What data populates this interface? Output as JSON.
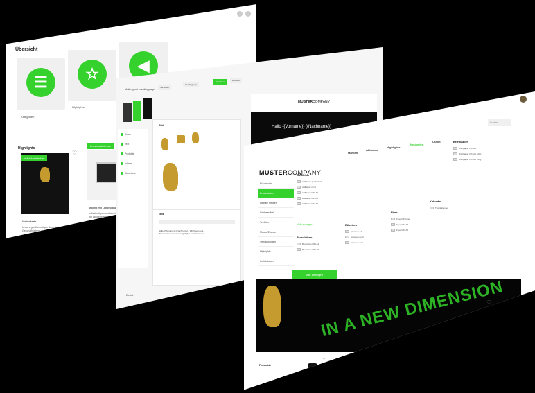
{
  "panel_overview": {
    "title": "Übersicht",
    "tiles": [
      {
        "label": "Kategorien",
        "icon": "list-icon"
      },
      {
        "label": "Highlights",
        "icon": "star-icon"
      },
      {
        "label": "",
        "icon": "megaphone-icon"
      }
    ],
    "highlights_title": "Highlights",
    "cards": [
      {
        "badge": "Individualisierbar",
        "title": "Visitenkarte",
        "text": "Unsere großformatigen Begleiter im Geschäftsleben, der edel auffällt."
      },
      {
        "badge": "Individualisierbar",
        "title": "Mailing mit Landingpage",
        "text": "Individuell personalisiertes Mailing mit Landingpage als Reaktions-..."
      }
    ]
  },
  "panel_editor": {
    "title": "Mailing mit Landingpage",
    "toolbar": [
      "Vorschau",
      "Landingpage",
      "Speichern",
      "Drucken"
    ],
    "side_items": [
      "Cover",
      "Text",
      "Produkte",
      "Inhalte",
      "Abschluss"
    ],
    "image_section": "Bild",
    "text_section": "Text",
    "text_body": "Hallo {{Vorname}} {{Nachname}}, Wir freuen uns, Ihnen unsere neuesten Highlights zu präsentieren.",
    "back_label": "Zurück",
    "mail_logo_bold": "MUSTER",
    "mail_logo_rest": "COMPANY",
    "mail_greeting": "Hallo {{Vorname}} {{Nachname}}"
  },
  "panel_shop": {
    "logo_bold": "MUSTER",
    "logo_rest": "COMPANY",
    "search_placeholder": "Suchen",
    "menu": [
      "Bürobedarf",
      "Drucksachen",
      "Digitale Medien",
      "Werbeartikel",
      "Textilien",
      "Messe/Events",
      "Verpackungen",
      "Highlights",
      "Kollektionen"
    ],
    "nav": [
      "Marken",
      "Aktionen",
      "Highlights",
      "Neuheiten",
      "Outlet"
    ],
    "columns": [
      {
        "head": "Aufkleber",
        "items": [
          "Aufkleber quadratisch",
          "Aufkleber rund",
          "Aufkleber DIN A5",
          "Aufkleber DIN A4",
          "Aufkleber DIN A3"
        ]
      },
      {
        "head": "Briefpapier",
        "items": [
          "Briefpapier DIN A4",
          "Briefpapier DIN A4 100g",
          "Briefpapier DIN A4 120g",
          "Briefpapier DIN A4 90g",
          "Briefpapier DIN A4 80g"
        ]
      },
      {
        "head": "Broschüren",
        "items": [
          "Broschüre DIN A4",
          "Broschüre DIN A5"
        ]
      },
      {
        "head": "Etiketten",
        "items": [
          "Etiketten A4",
          "Etiketten rund",
          "Etiketten oval"
        ]
      },
      {
        "head": "Flyer",
        "items": [
          "Flyer DIN lang",
          "Flyer DIN A6",
          "Flyer DIN A5"
        ]
      },
      {
        "head": "Kalender",
        "items": [
          "Tischkalender"
        ]
      }
    ],
    "more_link": "Mehr anzeigen",
    "all_products": "Alle anzeigen",
    "hero_slogan": "IN A NEW DIMENSION",
    "products_title": "Produkte"
  }
}
